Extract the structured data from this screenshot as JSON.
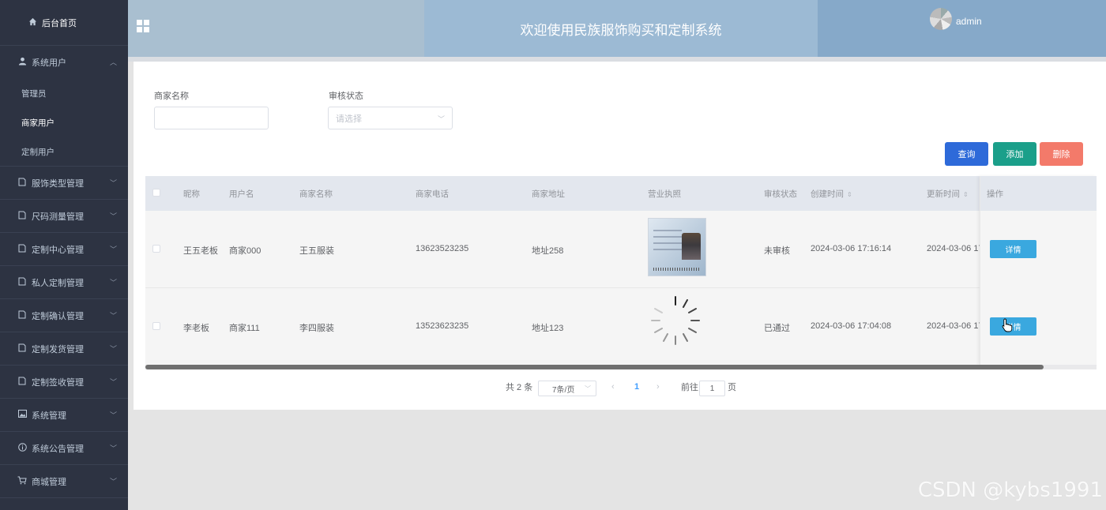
{
  "sidebar": {
    "home": "后台首页",
    "system_users": {
      "label": "系统用户",
      "items": [
        "管理员",
        "商家用户",
        "定制用户"
      ],
      "active": "商家用户"
    },
    "menus": [
      {
        "label": "服饰类型管理",
        "icon": "doc-icon"
      },
      {
        "label": "尺码测量管理",
        "icon": "doc-icon"
      },
      {
        "label": "定制中心管理",
        "icon": "doc-icon"
      },
      {
        "label": "私人定制管理",
        "icon": "doc-icon"
      },
      {
        "label": "定制确认管理",
        "icon": "doc-icon"
      },
      {
        "label": "定制发货管理",
        "icon": "doc-icon"
      },
      {
        "label": "定制签收管理",
        "icon": "doc-icon"
      },
      {
        "label": "系统管理",
        "icon": "image-icon"
      },
      {
        "label": "系统公告管理",
        "icon": "info-icon"
      },
      {
        "label": "商城管理",
        "icon": "cart-icon"
      }
    ]
  },
  "header": {
    "title": "欢迎使用民族服饰购买和定制系统",
    "user": "admin"
  },
  "filters": {
    "merchant_name_label": "商家名称",
    "merchant_name_value": "",
    "audit_status_label": "审核状态",
    "audit_status_placeholder": "请选择"
  },
  "actions": {
    "query": "查询",
    "add": "添加",
    "delete": "删除"
  },
  "table": {
    "columns": {
      "nickname": "昵称",
      "username": "用户名",
      "merchant_name": "商家名称",
      "phone": "商家电话",
      "address": "商家地址",
      "license": "营业执照",
      "audit": "审核状态",
      "created": "创建时间",
      "updated": "更新时间",
      "ops": "操作"
    },
    "rows": [
      {
        "nickname": "王五老板",
        "username": "商家000",
        "merchant_name": "王五服装",
        "phone": "13623523235",
        "address": "地址258",
        "audit": "未审核",
        "created": "2024-03-06 17:16:14",
        "updated": "2024-03-06 17",
        "detail": "详情"
      },
      {
        "nickname": "李老板",
        "username": "商家111",
        "merchant_name": "李四服装",
        "phone": "13523623235",
        "address": "地址123",
        "audit": "已通过",
        "created": "2024-03-06 17:04:08",
        "updated": "2024-03-06 17",
        "detail": "详情"
      }
    ]
  },
  "pagination": {
    "total": "共 2 条",
    "page_size": "7条/页",
    "current": "1",
    "goto_label": "前往",
    "goto_value": "1",
    "page_unit": "页"
  },
  "watermark": "CSDN @kybs1991",
  "colors": {
    "sidebar_bg": "#2d3342",
    "query": "#2e6ad9",
    "add": "#1b9f8a",
    "delete": "#f37a6a",
    "detail": "#3aa8df"
  }
}
